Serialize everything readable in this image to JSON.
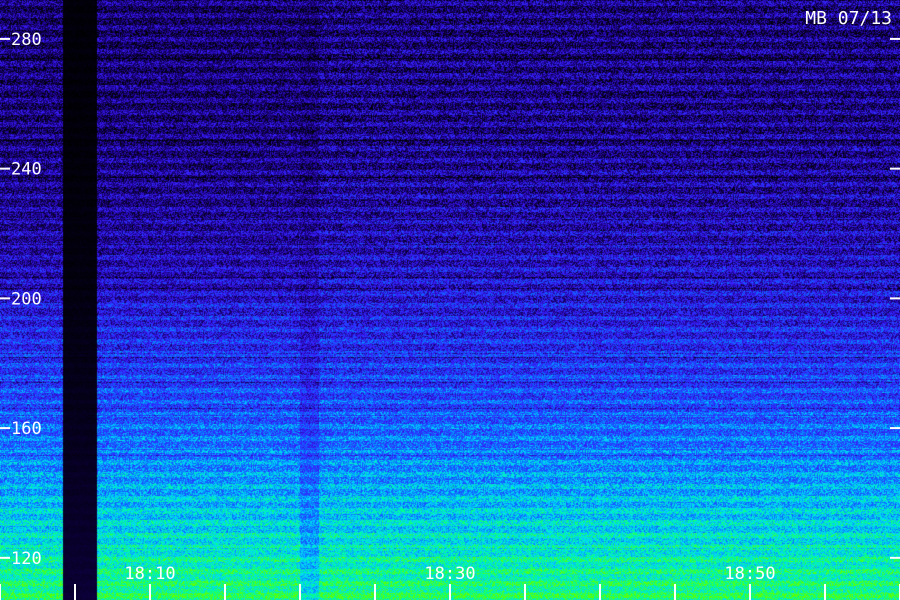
{
  "chart_data": {
    "type": "heatmap",
    "title": "MB 07/13",
    "xlabel": "",
    "ylabel": "",
    "y_ticks": [
      120,
      160,
      200,
      240,
      280
    ],
    "ylim": [
      107,
      292
    ],
    "x_ticks": [
      "18:10",
      "18:30",
      "18:50"
    ],
    "grid": false,
    "colormap": [
      "#000000",
      "#1a0080",
      "#3a1cff",
      "#0a6cff",
      "#00d8ff",
      "#00ff90",
      "#60ff00"
    ]
  }
}
